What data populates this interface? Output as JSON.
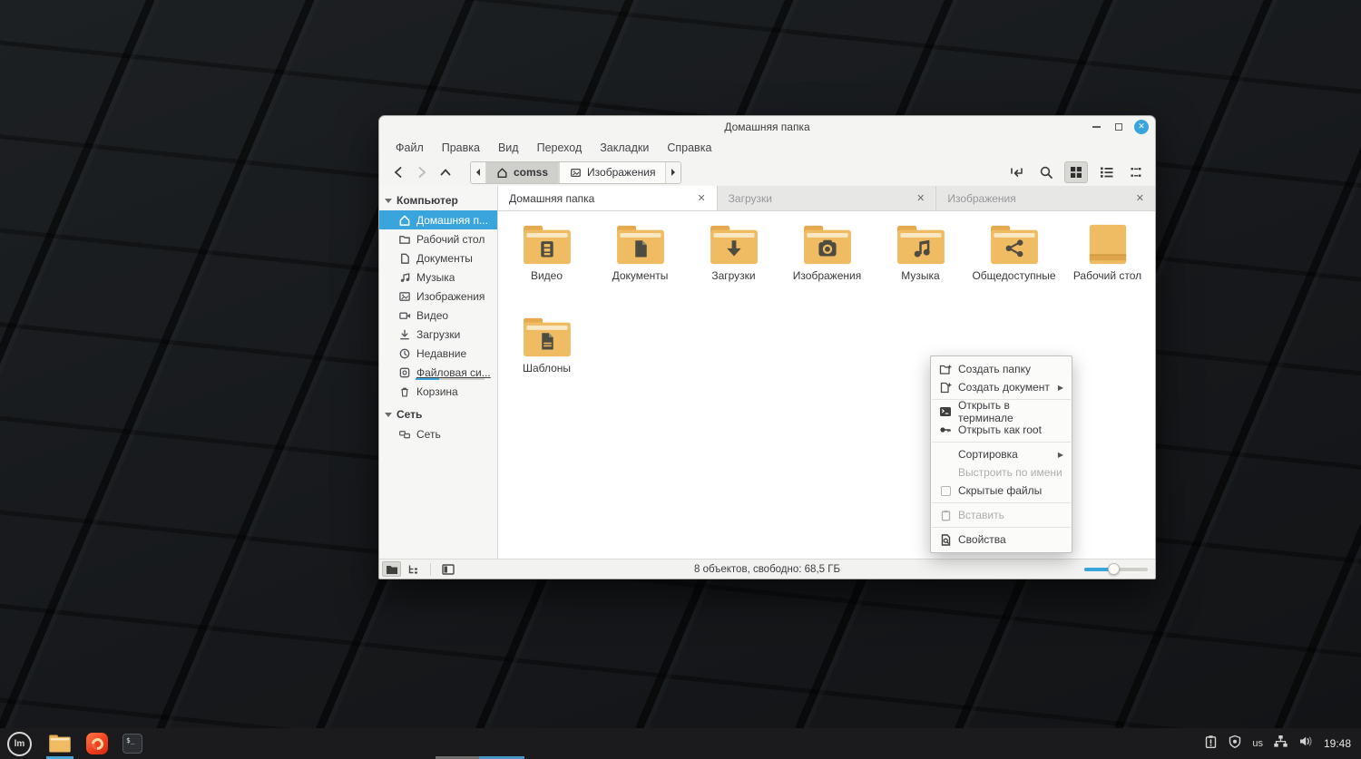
{
  "colors": {
    "accent": "#3aa5dc",
    "folder_body": "#f0bc63",
    "folder_flap": "#e5a94e",
    "folder_stripe": "#f8e8c4",
    "panel_bg": "#1b1b1d"
  },
  "window": {
    "title": "Домашняя папка",
    "menubar": {
      "items": [
        {
          "label": "Файл"
        },
        {
          "label": "Правка"
        },
        {
          "label": "Вид"
        },
        {
          "label": "Переход"
        },
        {
          "label": "Закладки"
        },
        {
          "label": "Справка"
        }
      ]
    },
    "pathbar": {
      "segments": [
        {
          "label": "comss"
        },
        {
          "label": "Изображения"
        }
      ]
    },
    "tabs": [
      {
        "label": "Домашняя папка"
      },
      {
        "label": "Загрузки"
      },
      {
        "label": "Изображения"
      }
    ],
    "sidebar": {
      "sections": [
        {
          "header": "Компьютер"
        },
        {
          "header": "Сеть"
        }
      ],
      "computer_items": [
        {
          "label": "Домашняя п..."
        },
        {
          "label": "Рабочий стол"
        },
        {
          "label": "Документы"
        },
        {
          "label": "Музыка"
        },
        {
          "label": "Изображения"
        },
        {
          "label": "Видео"
        },
        {
          "label": "Загрузки"
        },
        {
          "label": "Недавние"
        },
        {
          "label": "Файловая си..."
        },
        {
          "label": "Корзина"
        }
      ],
      "network_items": [
        {
          "label": "Сеть"
        }
      ]
    },
    "folders": [
      {
        "label": "Видео"
      },
      {
        "label": "Документы"
      },
      {
        "label": "Загрузки"
      },
      {
        "label": "Изображения"
      },
      {
        "label": "Музыка"
      },
      {
        "label": "Общедоступные"
      },
      {
        "label": "Рабочий стол"
      },
      {
        "label": "Шаблоны"
      }
    ],
    "context_menu": {
      "items": [
        {
          "label": "Создать папку"
        },
        {
          "label": "Создать документ"
        },
        {
          "label": "Открыть в терминале"
        },
        {
          "label": "Открыть как root"
        },
        {
          "label": "Сортировка"
        },
        {
          "label": "Выстроить по имени"
        },
        {
          "label": "Скрытые файлы"
        },
        {
          "label": "Вставить"
        },
        {
          "label": "Свойства"
        }
      ]
    },
    "statusbar": {
      "text": "8 объектов, свободно: 68,5 ГБ"
    }
  },
  "taskbar": {
    "keyboard_layout": "us",
    "clock": "19:48"
  }
}
